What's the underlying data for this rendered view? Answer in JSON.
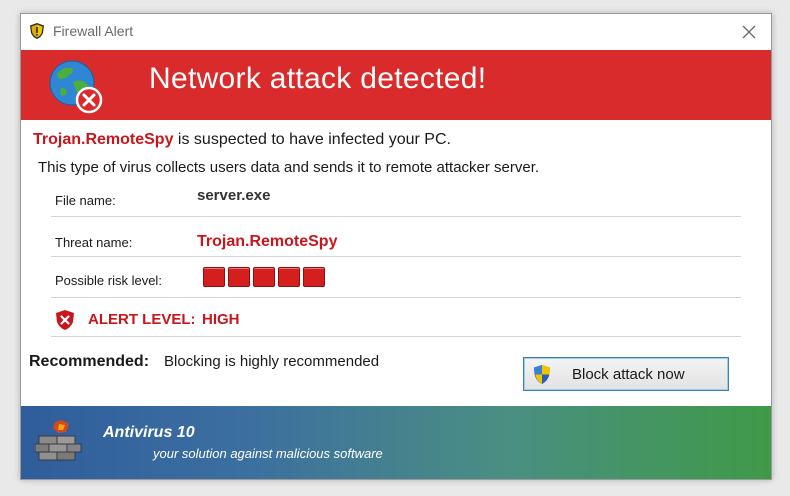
{
  "window": {
    "title": "Firewall Alert"
  },
  "banner": {
    "title": "Network attack detected!"
  },
  "intro": {
    "threat_name": "Trojan.RemoteSpy",
    "line1_rest": " is suspected to have infected your PC.",
    "line2": "This type of virus collects users data and sends it to remote attacker server."
  },
  "details": {
    "file_name_label": "File name:",
    "file_name_value": "server.exe",
    "threat_name_label": "Threat name:",
    "threat_name_value": "Trojan.RemoteSpy",
    "risk_label": "Possible risk level:",
    "risk_level": 5,
    "risk_max": 5,
    "alert_label": "ALERT LEVEL:",
    "alert_value": "HIGH"
  },
  "recommended": {
    "label": "Recommended:",
    "text": "Blocking is highly recommended"
  },
  "button": {
    "label": "Block attack now"
  },
  "footer": {
    "product": "Antivirus 10",
    "tagline": "your solution against malicious software"
  },
  "colors": {
    "banner": "#d92b2b",
    "threat_red": "#c8161d",
    "risk_block": "#d41f1f",
    "footer_start": "#2f5d9c",
    "footer_end": "#3f9a47"
  },
  "icons": {
    "title": "shield-icon",
    "banner": "globe-error-icon",
    "close": "close-icon",
    "alert": "alert-shield-icon",
    "button": "uac-shield-icon",
    "footer": "firewall-brick-icon"
  }
}
